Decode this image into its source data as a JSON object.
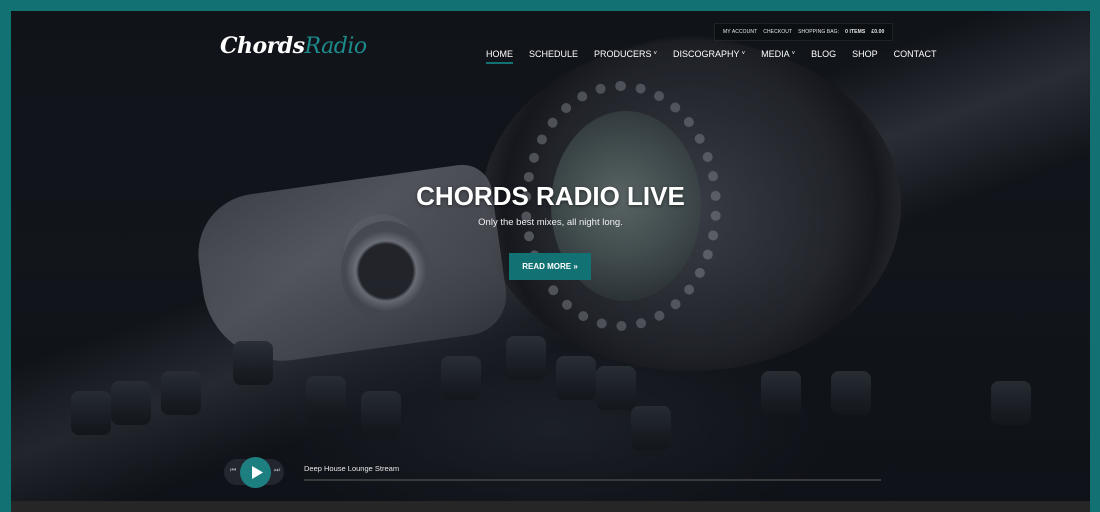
{
  "colors": {
    "accent": "#127173",
    "frame_border": "#127173",
    "bottom_bar": "#262626",
    "text": "#ffffff"
  },
  "topbar": {
    "my_account": "MY ACCOUNT",
    "checkout": "CHECKOUT",
    "shopping_bag_label": "SHOPPING BAG:",
    "items": "0 ITEMS",
    "total": "£0.00"
  },
  "logo": {
    "part1": "Chords",
    "part2": "Radio"
  },
  "nav": {
    "items": [
      {
        "label": "HOME",
        "active": true,
        "dropdown": false
      },
      {
        "label": "SCHEDULE",
        "active": false,
        "dropdown": false
      },
      {
        "label": "PRODUCERS",
        "active": false,
        "dropdown": true
      },
      {
        "label": "DISCOGRAPHY",
        "active": false,
        "dropdown": true
      },
      {
        "label": "MEDIA",
        "active": false,
        "dropdown": true
      },
      {
        "label": "BLOG",
        "active": false,
        "dropdown": false
      },
      {
        "label": "SHOP",
        "active": false,
        "dropdown": false
      },
      {
        "label": "CONTACT",
        "active": false,
        "dropdown": false
      }
    ],
    "caret_glyph": "˅"
  },
  "hero": {
    "title": "CHORDS RADIO LIVE",
    "subtitle": "Only the best mixes, all night long.",
    "button_label": "READ MORE »"
  },
  "player": {
    "stream_title": "Deep House Lounge Stream",
    "prev_icon": "skip-previous-icon",
    "play_icon": "play-icon",
    "next_icon": "skip-next-icon",
    "prev_glyph": "⏮",
    "next_glyph": "⏭",
    "progress": 0
  }
}
